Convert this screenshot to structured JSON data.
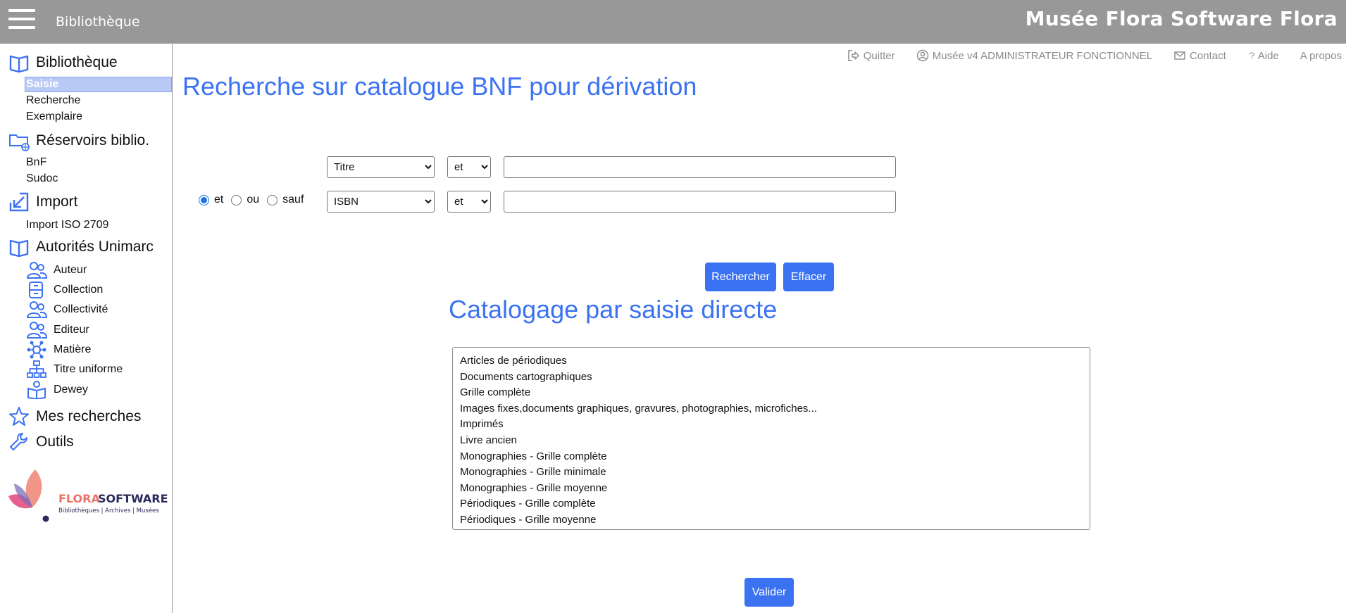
{
  "header": {
    "module": "Bibliothèque",
    "app_title": "Musée Flora Software Flora"
  },
  "top_links": [
    {
      "label": "Quitter",
      "icon": "logout-icon"
    },
    {
      "label": "Musée v4 ADMINISTRATEUR FONCTIONNEL",
      "icon": "user-circle-icon"
    },
    {
      "label": "Contact",
      "icon": "mail-icon"
    },
    {
      "label": "Aide",
      "icon": "question-icon"
    },
    {
      "label": "A propos",
      "icon": ""
    }
  ],
  "sidebar": {
    "bibliotheque": {
      "label": "Bibliothèque",
      "items": [
        "Saisie",
        "Recherche",
        "Exemplaire"
      ]
    },
    "reservoirs": {
      "label": "Réservoirs biblio.",
      "items": [
        "BnF",
        "Sudoc"
      ]
    },
    "import": {
      "label": "Import",
      "items": [
        "Import ISO 2709"
      ]
    },
    "autorites": {
      "label": "Autorités Unimarc",
      "items": [
        "Auteur",
        "Collection",
        "Collectivité",
        "Editeur",
        "Matière",
        "Titre uniforme",
        "Dewey"
      ]
    },
    "mes_recherches": {
      "label": "Mes recherches"
    },
    "outils": {
      "label": "Outils"
    }
  },
  "logo": {
    "name_part1": "FLORA",
    "name_part2": "SOFTWARE",
    "tagline": "Bibliothèques | Archives | Musées"
  },
  "search": {
    "title": "Recherche sur catalogue BNF pour dérivation",
    "row1": {
      "field": "Titre",
      "operator": "et",
      "value": ""
    },
    "row2": {
      "field": "ISBN",
      "operator": "et",
      "value": ""
    },
    "bool_options": [
      "et",
      "ou",
      "sauf"
    ],
    "bool_selected": "et",
    "search_button": "Rechercher",
    "clear_button": "Effacer"
  },
  "direct": {
    "title": "Catalogage par saisie directe",
    "options": [
      "Articles de périodiques",
      "Documents cartographiques",
      "Grille complète",
      "Images fixes,documents graphiques, gravures, photographies, microfiches...",
      "Imprimés",
      "Livre ancien",
      "Monographies - Grille complète",
      "Monographies - Grille minimale",
      "Monographies - Grille moyenne",
      "Périodiques - Grille complète",
      "Périodiques - Grille moyenne"
    ],
    "validate_button": "Valider"
  },
  "colors": {
    "accent": "#3b72f2",
    "topbar": "#989898",
    "selected_item": "#b8c9f6"
  }
}
